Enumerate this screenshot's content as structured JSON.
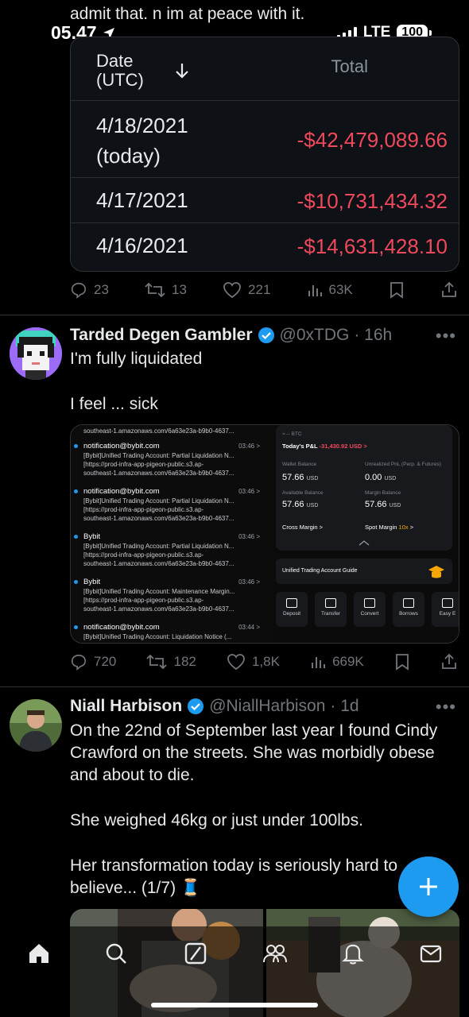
{
  "status_bar": {
    "time": "05.47",
    "network": "LTE",
    "battery": "100"
  },
  "prev_tweet": {
    "trailing_text": "admit that. n im at peace with it.",
    "table": {
      "col_date": "Date (UTC)",
      "col_total": "Total",
      "rows": [
        {
          "date": "4/18/2021 (today)",
          "total": "-$42,479,089.66"
        },
        {
          "date": "4/17/2021",
          "total": "-$10,731,434.32"
        },
        {
          "date": "4/16/2021",
          "total": "-$14,631,428.10"
        }
      ]
    },
    "stats": {
      "replies": "23",
      "retweets": "13",
      "likes": "221",
      "views": "63K"
    }
  },
  "tweet1": {
    "name": "Tarded Degen Gambler",
    "handle": "@0xTDG",
    "time": "· 16h",
    "line1": "I'm fully liquidated",
    "line2": "I feel ... sick",
    "emails": {
      "top_cut": "southeast-1.amazonaws.com/6a63e23a-b9b0-4637...",
      "items": [
        {
          "from": "notification@bybit.com",
          "time": "03:46 >",
          "subject": "[Bybit]Unified Trading Account: Partial Liquidation N...",
          "url1": "[https://prod-infra-app-pigeon-public.s3.ap-",
          "url2": "southeast-1.amazonaws.com/6a63e23a-b9b0-4637..."
        },
        {
          "from": "notification@bybit.com",
          "time": "03:46 >",
          "subject": "[Bybit]Unified Trading Account: Partial Liquidation N...",
          "url1": "[https://prod-infra-app-pigeon-public.s3.ap-",
          "url2": "southeast-1.amazonaws.com/6a63e23a-b9b0-4637..."
        },
        {
          "from": "Bybit",
          "time": "03:46 >",
          "subject": "[Bybit]Unified Trading Account: Partial Liquidation N...",
          "url1": "[https://prod-infra-app-pigeon-public.s3.ap-",
          "url2": "southeast-1.amazonaws.com/6a63e23a-b9b0-4637..."
        },
        {
          "from": "Bybit",
          "time": "03:46 >",
          "subject": "[Bybit]Unified Trading Account: Maintenance Margin...",
          "url1": "[https://prod-infra-app-pigeon-public.s3.ap-",
          "url2": "southeast-1.amazonaws.com/6a63e23a-b9b0-4637..."
        },
        {
          "from": "notification@bybit.com",
          "time": "03:44 >",
          "subject": "[Bybit]Unified Trading Account: Liquidation Notice (...",
          "url1": "",
          "url2": ""
        }
      ]
    },
    "bybit": {
      "btc": "≈ -- BTC",
      "pnl_label": "Today's P&L",
      "pnl_value": "-31,430.92 USD >",
      "wallet_label": "Wallet Balance",
      "wallet_value": "57.66",
      "unrealized_label": "Unrealized PnL (Perp. & Futures)",
      "unrealized_value": "0.00",
      "available_label": "Available Balance",
      "available_value": "57.66",
      "margin_label": "Margin Balance",
      "margin_value": "57.66",
      "currency": "USD",
      "cross_margin": "Cross Margin  >",
      "spot_margin": "Spot Margin",
      "spot_margin_x": "10x",
      "uta": "Unified Trading Account Guide",
      "buttons": [
        "Deposit",
        "Transfer",
        "Convert",
        "Borrows",
        "Easy E"
      ]
    },
    "stats": {
      "replies": "720",
      "retweets": "182",
      "likes": "1,8K",
      "views": "669K"
    }
  },
  "tweet2": {
    "name": "Niall Harbison",
    "handle": "@NiallHarbison",
    "time": "· 1d",
    "p1": "On the 22nd of September last year I found Cindy Crawford on the streets. She was morbidly obese and about to die.",
    "p2": "She weighed 46kg or just under 100lbs.",
    "p3": "Her transformation today is seriously hard to believe... (1/7) 🧵"
  },
  "colors": {
    "accent": "#1d9bf0",
    "negative": "#f0495c",
    "muted": "#71767b"
  }
}
